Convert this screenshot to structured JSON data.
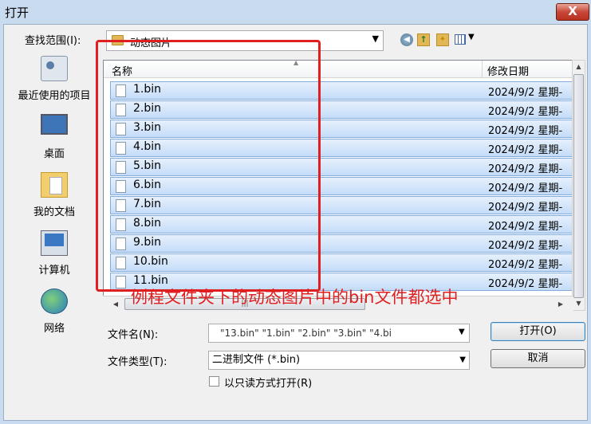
{
  "window": {
    "title": "打开",
    "close_glyph": "X"
  },
  "toolbar": {
    "look_in_label": "查找范围(I):",
    "look_in_value": "动态图片",
    "view_menu_arrow": "▼"
  },
  "places": [
    {
      "label": "最近使用的项目",
      "icon": "recent-icon"
    },
    {
      "label": "桌面",
      "icon": "desktop-icon"
    },
    {
      "label": "我的文档",
      "icon": "documents-icon"
    },
    {
      "label": "计算机",
      "icon": "computer-icon"
    },
    {
      "label": "网络",
      "icon": "network-icon"
    }
  ],
  "list": {
    "columns": {
      "name": "名称",
      "date": "修改日期"
    },
    "rows": [
      {
        "name": "1.bin",
        "date": "2024/9/2 星期-"
      },
      {
        "name": "2.bin",
        "date": "2024/9/2 星期-"
      },
      {
        "name": "3.bin",
        "date": "2024/9/2 星期-"
      },
      {
        "name": "4.bin",
        "date": "2024/9/2 星期-"
      },
      {
        "name": "5.bin",
        "date": "2024/9/2 星期-"
      },
      {
        "name": "6.bin",
        "date": "2024/9/2 星期-"
      },
      {
        "name": "7.bin",
        "date": "2024/9/2 星期-"
      },
      {
        "name": "8.bin",
        "date": "2024/9/2 星期-"
      },
      {
        "name": "9.bin",
        "date": "2024/9/2 星期-"
      },
      {
        "name": "10.bin",
        "date": "2024/9/2 星期-"
      },
      {
        "name": "11.bin",
        "date": "2024/9/2 星期-"
      }
    ]
  },
  "annotation": "例程文件夹下的动态图片中的bin文件都选中",
  "filename": {
    "label": "文件名(N):",
    "value": "\"13.bin\" \"1.bin\" \"2.bin\" \"3.bin\" \"4.bi"
  },
  "filetype": {
    "label": "文件类型(T):",
    "value": "二进制文件 (*.bin)"
  },
  "buttons": {
    "open": "打开(O)",
    "cancel": "取消"
  },
  "readonly_label": "以只读方式打开(R)",
  "colors": {
    "annotation": "#e02020",
    "selection": "#c4dcf8",
    "title_bar": "#c9dbee"
  }
}
